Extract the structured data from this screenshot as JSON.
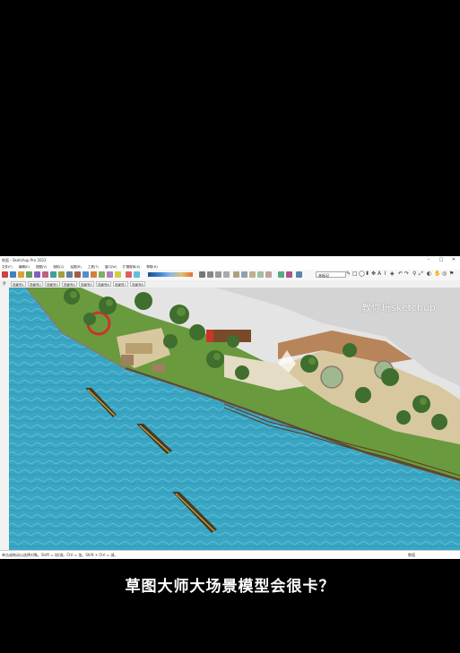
{
  "app": {
    "title": "Sketchup Pro 2022",
    "window_prefix": "地面",
    "menu": [
      "文件(F)",
      "编辑(E)",
      "视图(V)",
      "相机(C)",
      "绘图(R)",
      "工具(T)",
      "窗口(W)",
      "扩展程序(X)",
      "帮助(H)"
    ],
    "layer_value": "未标记",
    "scene_tabs": [
      "场景号1",
      "场景号2",
      "场景号3",
      "场景号4",
      "场景号5",
      "场景号6",
      "场景号7",
      "场景号8"
    ],
    "status_text": "单击或拖动以选择对象。Shift = 加/减。Ctrl = 加。Shift + Ctrl = 减。",
    "measurement_label": "数值"
  },
  "overlay": {
    "watermark": "教你玩sketchup",
    "caption": "草图大师大场景模型会很卡？"
  },
  "colors": {
    "water": "#3aa6c4",
    "river_edge": "#2f8fae",
    "grass": "#6a9a3e",
    "paving": "#d8c8a0",
    "wall": "#7a4a28",
    "red_accent": "#c8352a"
  },
  "icons": {
    "close": "close-icon",
    "minimize": "minimize-icon",
    "maximize": "maximize-icon"
  }
}
